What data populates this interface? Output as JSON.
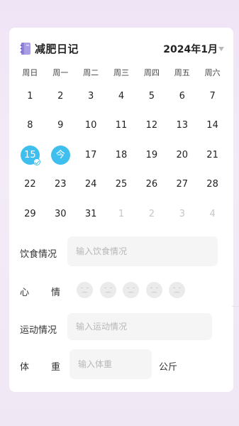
{
  "header": {
    "title": "减肥日记",
    "month_label": "2024年1月"
  },
  "weekdays": [
    "周日",
    "周一",
    "周二",
    "周三",
    "周四",
    "周五",
    "周六"
  ],
  "calendar": {
    "rows": [
      [
        {
          "d": "1"
        },
        {
          "d": "2"
        },
        {
          "d": "3"
        },
        {
          "d": "4"
        },
        {
          "d": "5"
        },
        {
          "d": "6"
        },
        {
          "d": "7"
        }
      ],
      [
        {
          "d": "8"
        },
        {
          "d": "9"
        },
        {
          "d": "10"
        },
        {
          "d": "11"
        },
        {
          "d": "12"
        },
        {
          "d": "13"
        },
        {
          "d": "14"
        }
      ],
      [
        {
          "d": "15",
          "state": "selected-checked"
        },
        {
          "d": "今",
          "state": "today"
        },
        {
          "d": "17"
        },
        {
          "d": "18"
        },
        {
          "d": "19"
        },
        {
          "d": "20"
        },
        {
          "d": "21"
        }
      ],
      [
        {
          "d": "22"
        },
        {
          "d": "23"
        },
        {
          "d": "24"
        },
        {
          "d": "25"
        },
        {
          "d": "26"
        },
        {
          "d": "27"
        },
        {
          "d": "28"
        }
      ],
      [
        {
          "d": "29"
        },
        {
          "d": "30"
        },
        {
          "d": "31"
        },
        {
          "d": "1",
          "state": "muted"
        },
        {
          "d": "2",
          "state": "muted"
        },
        {
          "d": "3",
          "state": "muted"
        },
        {
          "d": "4",
          "state": "muted"
        }
      ]
    ],
    "accent_color": "#3fbfee"
  },
  "form": {
    "diet": {
      "label": "饮食情况",
      "placeholder": "输入饮食情况"
    },
    "mood": {
      "label_chars": [
        "心",
        "情"
      ],
      "faces": [
        "neutral-face-icon",
        "neutral-face-icon",
        "neutral-face-icon",
        "neutral-face-icon",
        "neutral-face-icon"
      ]
    },
    "exercise": {
      "label": "运动情况",
      "placeholder": "输入运动情况"
    },
    "weight": {
      "label_chars": [
        "体",
        "重"
      ],
      "placeholder": "输入体重",
      "unit": "公斤"
    }
  }
}
